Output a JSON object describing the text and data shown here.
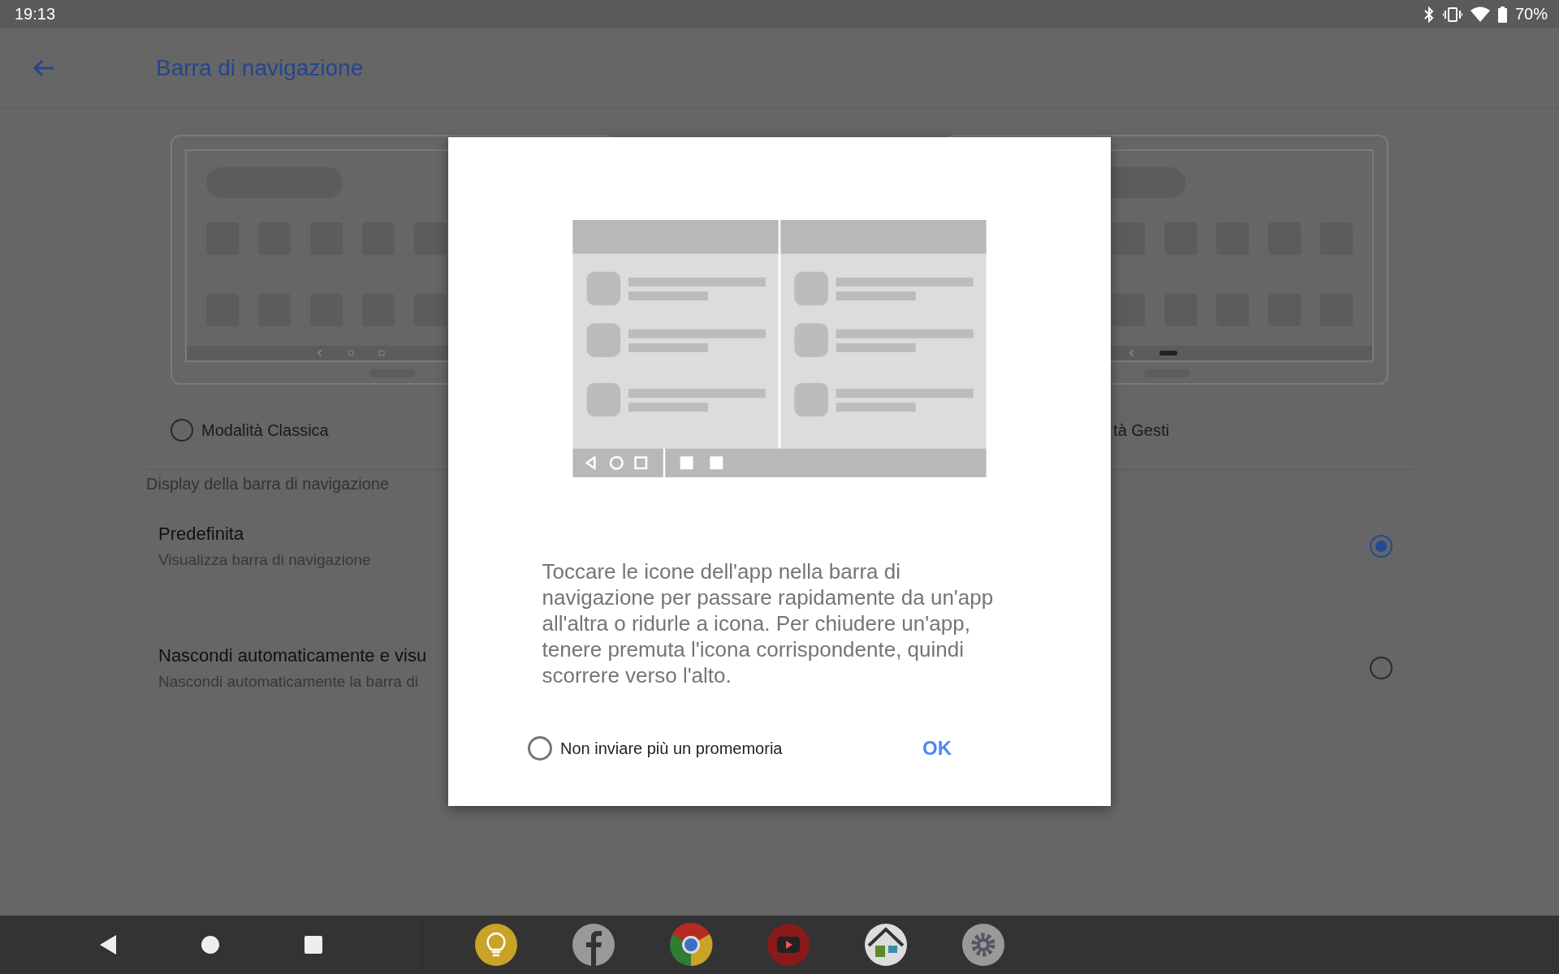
{
  "status_bar": {
    "time": "19:13",
    "battery": "70%"
  },
  "header": {
    "title": "Barra di navigazione"
  },
  "modes": [
    {
      "label": "Modalità Classica",
      "selected": false
    },
    {
      "label": "tà Gesti"
    }
  ],
  "section_title": "Display della barra di navigazione",
  "options": [
    {
      "title": "Predefinita",
      "subtitle": "Visualizza barra di navigazione",
      "selected": true
    },
    {
      "title": "Nascondi automaticamente e visu",
      "subtitle": "Nascondi automaticamente la barra di",
      "selected": false
    }
  ],
  "dialog": {
    "message": "Toccare le icone dell'app nella barra di navigazione per passare rapidamente da un'app all'altra o ridurle a icona. Per chiudere un'app, tenere premuta l'icona corrispondente, quindi scorrere verso l'alto.",
    "checkbox": {
      "label": "Non inviare più un promemoria",
      "checked": false
    },
    "button": "OK"
  }
}
